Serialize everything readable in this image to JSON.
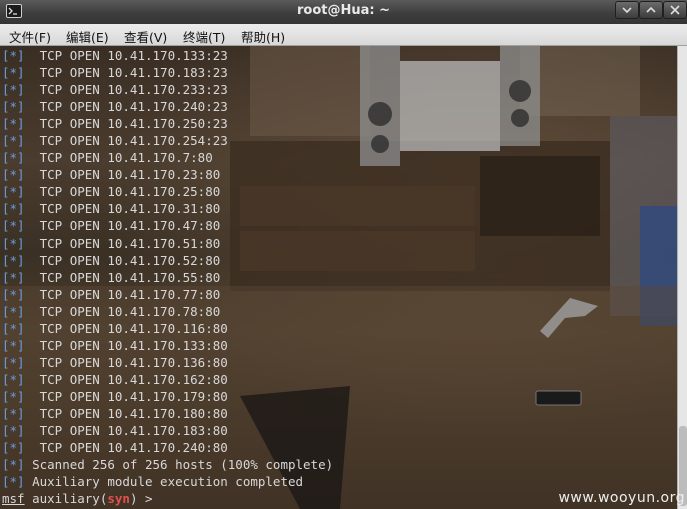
{
  "window": {
    "title": "root@Hua: ~",
    "icon": "terminal-icon",
    "controls": [
      "minimize-icon",
      "maximize-icon",
      "close-icon"
    ]
  },
  "menu": [
    {
      "label": "文件(F)"
    },
    {
      "label": "编辑(E)"
    },
    {
      "label": "查看(V)"
    },
    {
      "label": "终端(T)"
    },
    {
      "label": "帮助(H)"
    }
  ],
  "terminal": {
    "lines": [
      {
        "tag": "[*]",
        "text": "  TCP OPEN 10.41.170.133:23"
      },
      {
        "tag": "[*]",
        "text": "  TCP OPEN 10.41.170.183:23"
      },
      {
        "tag": "[*]",
        "text": "  TCP OPEN 10.41.170.233:23"
      },
      {
        "tag": "[*]",
        "text": "  TCP OPEN 10.41.170.240:23"
      },
      {
        "tag": "[*]",
        "text": "  TCP OPEN 10.41.170.250:23"
      },
      {
        "tag": "[*]",
        "text": "  TCP OPEN 10.41.170.254:23"
      },
      {
        "tag": "[*]",
        "text": "  TCP OPEN 10.41.170.7:80"
      },
      {
        "tag": "[*]",
        "text": "  TCP OPEN 10.41.170.23:80"
      },
      {
        "tag": "[*]",
        "text": "  TCP OPEN 10.41.170.25:80"
      },
      {
        "tag": "[*]",
        "text": "  TCP OPEN 10.41.170.31:80"
      },
      {
        "tag": "[*]",
        "text": "  TCP OPEN 10.41.170.47:80"
      },
      {
        "tag": "[*]",
        "text": "  TCP OPEN 10.41.170.51:80"
      },
      {
        "tag": "[*]",
        "text": "  TCP OPEN 10.41.170.52:80"
      },
      {
        "tag": "[*]",
        "text": "  TCP OPEN 10.41.170.55:80"
      },
      {
        "tag": "[*]",
        "text": "  TCP OPEN 10.41.170.77:80"
      },
      {
        "tag": "[*]",
        "text": "  TCP OPEN 10.41.170.78:80"
      },
      {
        "tag": "[*]",
        "text": "  TCP OPEN 10.41.170.116:80"
      },
      {
        "tag": "[*]",
        "text": "  TCP OPEN 10.41.170.133:80"
      },
      {
        "tag": "[*]",
        "text": "  TCP OPEN 10.41.170.136:80"
      },
      {
        "tag": "[*]",
        "text": "  TCP OPEN 10.41.170.162:80"
      },
      {
        "tag": "[*]",
        "text": "  TCP OPEN 10.41.170.179:80"
      },
      {
        "tag": "[*]",
        "text": "  TCP OPEN 10.41.170.180:80"
      },
      {
        "tag": "[*]",
        "text": "  TCP OPEN 10.41.170.183:80"
      },
      {
        "tag": "[*]",
        "text": "  TCP OPEN 10.41.170.240:80"
      },
      {
        "tag": "[*]",
        "text": " Scanned 256 of 256 hosts (100% complete)"
      },
      {
        "tag": "[*]",
        "text": " Auxiliary module execution completed"
      }
    ],
    "prompt": {
      "msf": "msf",
      "module_prefix": " auxiliary(",
      "module": "syn",
      "suffix": ") > "
    }
  },
  "watermark": "www.wooyun.org",
  "colors": {
    "tag": "#6a9edc",
    "text": "#d8d8d8",
    "module": "#e05050"
  }
}
